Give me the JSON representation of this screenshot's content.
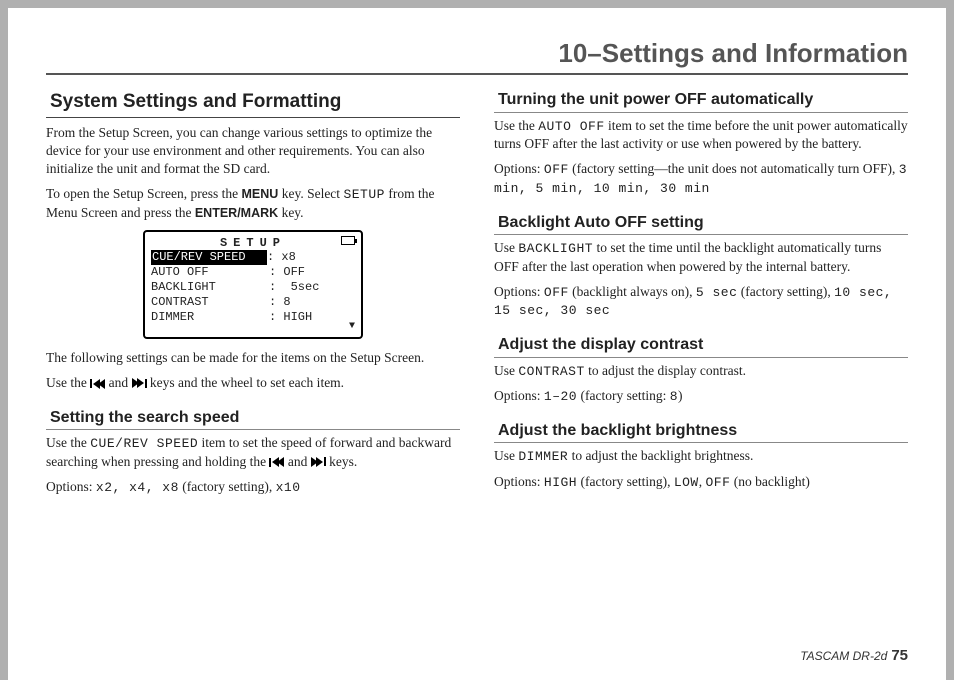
{
  "chapter_title": "10–Settings and Information",
  "left": {
    "section_title": "System Settings and Formatting",
    "intro1": "From the Setup Screen, you can change various settings to optimize the device for your use environment and other requirements. You can also initialize the unit and format the SD card.",
    "intro2_a": "To open the Setup Screen, press the ",
    "menu_key": "MENU",
    "intro2_b": " key. Select ",
    "setup_lcd": "SETUP",
    "intro2_c": " from the Menu Screen and press the ",
    "enter_key": "ENTER/MARK",
    "intro2_d": " key.",
    "after_screen": "The following settings can be made for the items on the Setup Screen.",
    "use_keys_a": "Use the ",
    "use_keys_b": " and ",
    "use_keys_c": " keys and the wheel to set each item.",
    "lcd": {
      "title": "SETUP",
      "rows": [
        {
          "label": "CUE/REV SPEED",
          "value": ": x8",
          "selected": true
        },
        {
          "label": "AUTO OFF",
          "value": ": OFF"
        },
        {
          "label": "BACKLIGHT",
          "value": ":  5sec"
        },
        {
          "label": "CONTRAST",
          "value": ": 8"
        },
        {
          "label": "DIMMER",
          "value": ": HIGH"
        }
      ]
    },
    "sub1": {
      "title": "Setting the search speed",
      "p1_a": "Use the ",
      "p1_lcd": "CUE/REV SPEED",
      "p1_b": " item to set the speed of forward and backward searching when pressing and holding the ",
      "p1_c": " and ",
      "p1_d": " keys.",
      "opts_a": "Options: ",
      "opts_vals": "x2, x4, x8",
      "opts_b": " (factory setting), ",
      "opts_last": "x10"
    }
  },
  "right": {
    "sub1": {
      "title": "Turning the unit power OFF automatically",
      "p1_a": "Use the ",
      "p1_lcd": "AUTO OFF",
      "p1_b": " item to set the time before the unit power automatically turns OFF after the last activity or use when powered by the battery.",
      "opts_a": "Options: ",
      "opts_off": "OFF",
      "opts_b": " (factory setting—the unit does not automatically turn OFF), ",
      "opts_vals": "3 min, 5 min, 10 min, 30 min"
    },
    "sub2": {
      "title": "Backlight Auto OFF setting",
      "p1_a": "Use ",
      "p1_lcd": "BACKLIGHT",
      "p1_b": " to set the time until the backlight automatically turns OFF after the last operation when powered by the internal battery.",
      "opts_a": "Options: ",
      "opts_off": "OFF",
      "opts_b": " (backlight always on), ",
      "opts_fact": "5 sec",
      "opts_c": " (factory setting), ",
      "opts_vals": "10 sec, 15 sec, 30 sec"
    },
    "sub3": {
      "title": "Adjust the display contrast",
      "p1_a": "Use ",
      "p1_lcd": "CONTRAST",
      "p1_b": " to adjust the display contrast.",
      "opts_a": "Options: ",
      "opts_range": "1–20",
      "opts_b": " (factory setting: ",
      "opts_fact": "8",
      "opts_c": ")"
    },
    "sub4": {
      "title": "Adjust the backlight brightness",
      "p1_a": "Use ",
      "p1_lcd": "DIMMER",
      "p1_b": " to adjust the backlight brightness.",
      "opts_a": "Options: ",
      "opts_high": "HIGH",
      "opts_b": " (factory setting), ",
      "opts_low": "LOW",
      "opts_c": ", ",
      "opts_off": "OFF",
      "opts_d": " (no backlight)"
    }
  },
  "footer": {
    "product": "TASCAM  DR-2d",
    "page": "75"
  }
}
